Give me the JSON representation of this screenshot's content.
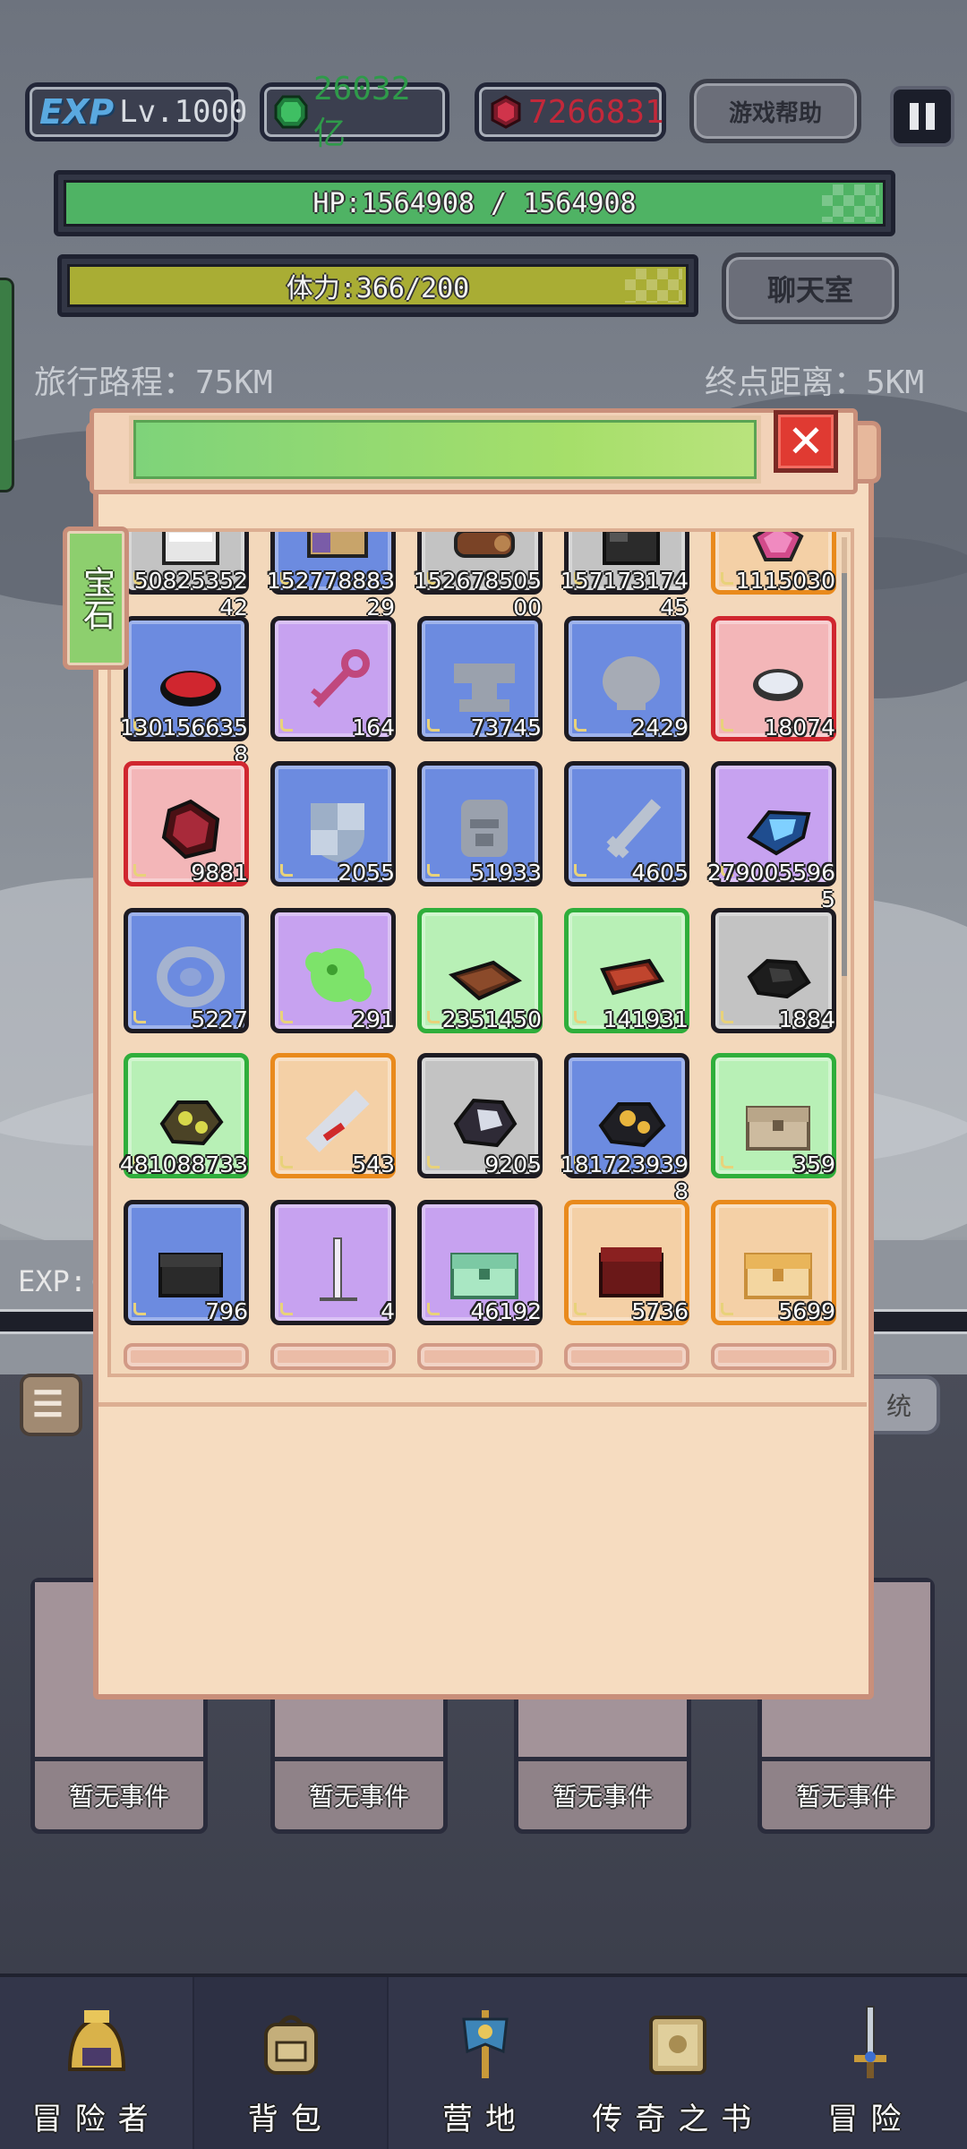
{
  "header": {
    "exp_badge": "EXP",
    "level": "Lv.1000",
    "emerald": "26032亿",
    "ruby": "7266831",
    "help_button": "游戏帮助"
  },
  "status": {
    "hp": "HP:1564908 / 1564908",
    "stamina": "体力:366/200",
    "chat_button": "聊天室",
    "journey": "旅行路程：75KM",
    "distance": "终点距离：5KM",
    "exp_label": "EXP:("
  },
  "modal": {
    "tab_label": "宝石",
    "close_icon": "close-x",
    "items": [
      {
        "color": "grey",
        "icon": "white-block",
        "count": "50825352",
        "count2": "42"
      },
      {
        "color": "blue",
        "icon": "scroll",
        "count": "152778883",
        "count2": "29"
      },
      {
        "color": "grey",
        "icon": "log",
        "count": "152678505",
        "count2": "00"
      },
      {
        "color": "grey",
        "icon": "black-block",
        "count": "157173174",
        "count2": "45"
      },
      {
        "color": "orange",
        "icon": "pink-gem",
        "count": "1115030",
        "count2": ""
      },
      {
        "color": "blue",
        "icon": "red-disc",
        "count": "130156635",
        "count2": "8"
      },
      {
        "color": "purple",
        "icon": "pink-key",
        "count": "164",
        "count2": ""
      },
      {
        "color": "blue",
        "icon": "grey-anvil",
        "count": "73745",
        "count2": ""
      },
      {
        "color": "blue",
        "icon": "grey-skull",
        "count": "2429",
        "count2": ""
      },
      {
        "color": "red",
        "icon": "silver-disc",
        "count": "18074",
        "count2": ""
      },
      {
        "color": "red",
        "icon": "ruby-ore",
        "count": "9881",
        "count2": ""
      },
      {
        "color": "blue",
        "icon": "shield",
        "count": "2055",
        "count2": ""
      },
      {
        "color": "blue",
        "icon": "helmet",
        "count": "51933",
        "count2": ""
      },
      {
        "color": "blue",
        "icon": "sword",
        "count": "4605",
        "count2": ""
      },
      {
        "color": "purple",
        "icon": "blue-crystal",
        "count": "279005596",
        "count2": "5"
      },
      {
        "color": "blue",
        "icon": "ring",
        "count": "5227",
        "count2": ""
      },
      {
        "color": "purple",
        "icon": "green-slime",
        "count": "291",
        "count2": ""
      },
      {
        "color": "green",
        "icon": "wood-plank",
        "count": "2351450",
        "count2": ""
      },
      {
        "color": "green",
        "icon": "brick",
        "count": "141931",
        "count2": ""
      },
      {
        "color": "grey",
        "icon": "coal",
        "count": "1884",
        "count2": ""
      },
      {
        "color": "green",
        "icon": "gold-ore",
        "count": "481088733",
        "count2": ""
      },
      {
        "color": "orange",
        "icon": "scroll-red",
        "count": "543",
        "count2": ""
      },
      {
        "color": "grey",
        "icon": "silver-ore",
        "count": "9205",
        "count2": ""
      },
      {
        "color": "blue",
        "icon": "gold-nugget",
        "count": "181723939",
        "count2": "8"
      },
      {
        "color": "green",
        "icon": "wood-chest",
        "count": "359",
        "count2": ""
      },
      {
        "color": "blue",
        "icon": "black-chest",
        "count": "796",
        "count2": ""
      },
      {
        "color": "purple",
        "icon": "candle",
        "count": "4",
        "count2": ""
      },
      {
        "color": "purple",
        "icon": "jade-chest",
        "count": "46192",
        "count2": ""
      },
      {
        "color": "orange",
        "icon": "red-chest",
        "count": "5736",
        "count2": ""
      },
      {
        "color": "orange",
        "icon": "gold-chest",
        "count": "5699",
        "count2": ""
      }
    ]
  },
  "side": {
    "right_button": "统"
  },
  "events": [
    {
      "label": "暂无事件"
    },
    {
      "label": "暂无事件"
    },
    {
      "label": "暂无事件"
    },
    {
      "label": "暂无事件"
    }
  ],
  "nav": [
    {
      "label": "冒险者",
      "icon": "helmet-icon",
      "active": false
    },
    {
      "label": "背包",
      "icon": "backpack-icon",
      "active": true
    },
    {
      "label": "营地",
      "icon": "banner-icon",
      "active": false
    },
    {
      "label": "传奇之书",
      "icon": "book-icon",
      "active": false
    },
    {
      "label": "冒险",
      "icon": "sword-icon",
      "active": false
    }
  ],
  "colors": {
    "hp": "#4fb364",
    "stamina": "#a9ad34",
    "close": "#e03a32",
    "tab": "#8dcf6e"
  }
}
